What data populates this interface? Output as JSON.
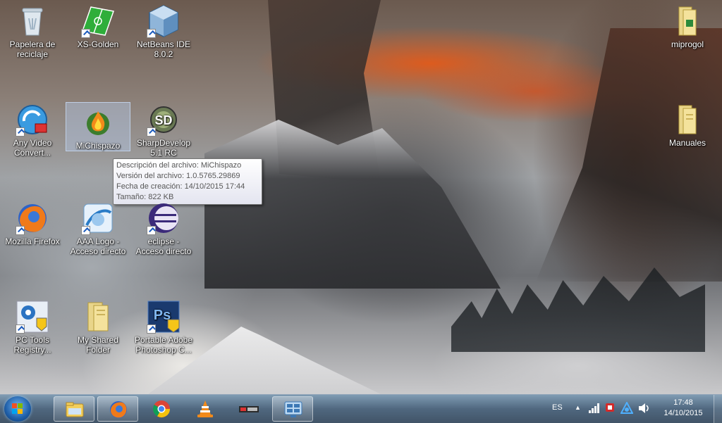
{
  "desktop": {
    "icons": [
      {
        "label": "Papelera de reciclaje"
      },
      {
        "label": "XS-Golden"
      },
      {
        "label": "NetBeans IDE 8.0.2"
      },
      {
        "label": "Any Video Convert..."
      },
      {
        "label": "MiChispazo"
      },
      {
        "label": "SharpDevelop 5.1 RC"
      },
      {
        "label": "Mozilla Firefox"
      },
      {
        "label": "AAA Logo - Acceso directo"
      },
      {
        "label": "eclipse - Acceso directo"
      },
      {
        "label": "PC Tools Registry..."
      },
      {
        "label": "My Shared Folder"
      },
      {
        "label": "Portable Adobe Photoshop C..."
      },
      {
        "label": "miprogol"
      },
      {
        "label": "Manuales"
      }
    ]
  },
  "tooltip": {
    "line1": "Descripción del archivo: MiChispazo",
    "line2": "Versión del archivo: 1.0.5765.29869",
    "line3": "Fecha de creación: 14/10/2015 17:44",
    "line4": "Tamaño: 822 KB"
  },
  "taskbar": {
    "buttons": [
      "Explorador de Windows",
      "Mozilla Firefox",
      "Google Chrome",
      "VLC",
      "MiProgol",
      "Panel"
    ],
    "language": "ES",
    "time": "17:48",
    "date": "14/10/2015"
  }
}
